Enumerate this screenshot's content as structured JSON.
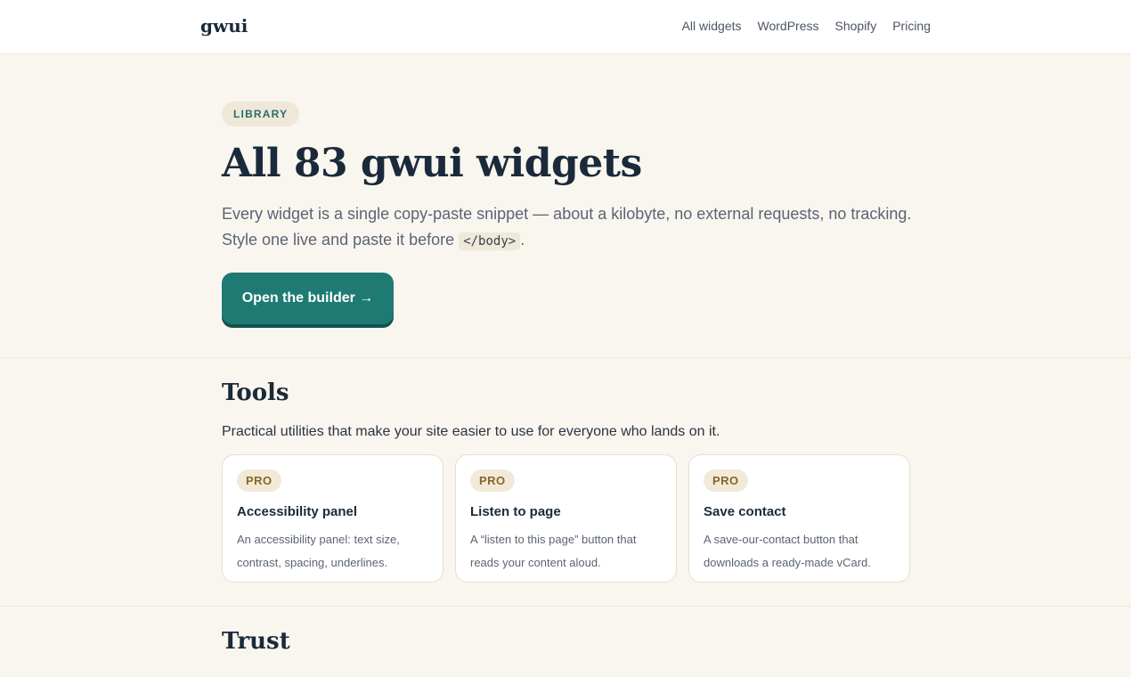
{
  "header": {
    "logo": "gwui",
    "nav": [
      "All widgets",
      "WordPress",
      "Shopify",
      "Pricing"
    ]
  },
  "hero": {
    "badge": "LIBRARY",
    "title": "All 83 gwui widgets",
    "desc_line1": "Every widget is a single copy-paste snippet — about a kilobyte, no external requests, no tracking.",
    "desc_line2_prefix": "Style one live and paste it before",
    "desc_code": "</body>",
    "desc_line2_suffix": ".",
    "cta_label": "Open the builder →"
  },
  "sections": {
    "tools": {
      "title": "Tools",
      "desc": "Practical utilities that make your site easier to use for everyone who lands on it.",
      "cards": [
        {
          "badge": "PRO",
          "title": "Accessibility panel",
          "desc": "An accessibility panel: text size, contrast, spacing, underlines."
        },
        {
          "badge": "PRO",
          "title": "Listen to page",
          "desc": "A “listen to this page” button that reads your content aloud."
        },
        {
          "badge": "PRO",
          "title": "Save contact",
          "desc": "A save-our-contact button that downloads a ready-made vCard."
        }
      ]
    },
    "trust": {
      "title": "Trust"
    }
  },
  "colors": {
    "accent": "#1f7a73",
    "background": "#f9f6f0",
    "pro_badge": "#8a6622"
  }
}
